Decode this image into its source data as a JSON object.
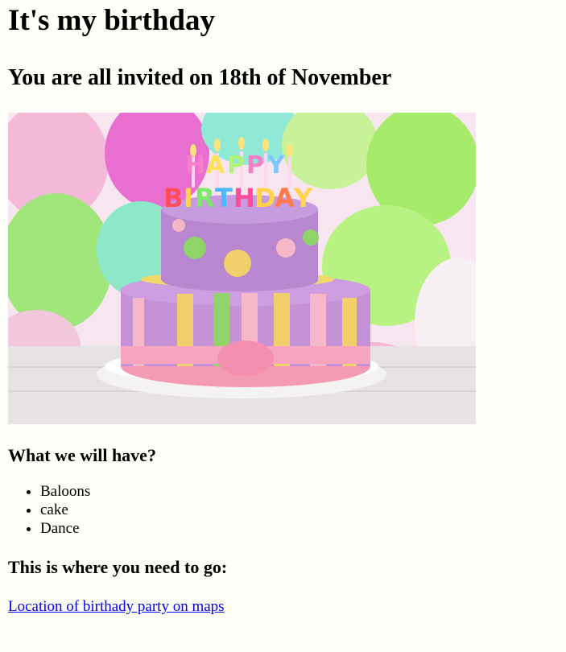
{
  "page": {
    "title": "It's my birthday",
    "subtitle": "You are all invited on 18th of November",
    "image": {
      "description": "cake-photo"
    },
    "have_heading": "What we will have?",
    "items": [
      "Baloons",
      "cake",
      "Dance"
    ],
    "go_heading": "This is where you need to go:",
    "link_text": "Location of birthady party on maps"
  },
  "colors": {
    "background": "#fffffa",
    "link": "#0000ee"
  }
}
